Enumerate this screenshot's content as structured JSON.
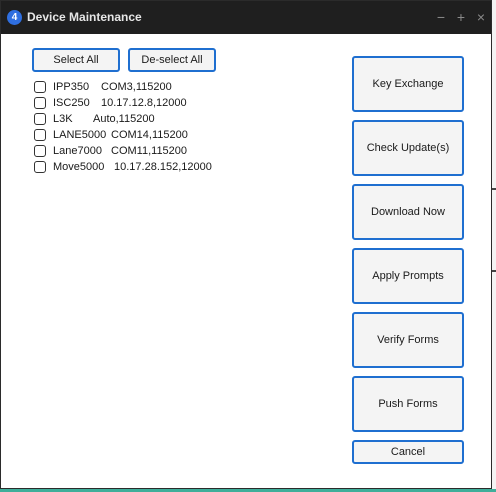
{
  "window": {
    "title": "Device Maintenance",
    "app_icon_label": "4",
    "controls": {
      "minimize": "−",
      "maximize": "+",
      "close": "×"
    }
  },
  "selection": {
    "select_all": "Select All",
    "deselect_all": "De-select All"
  },
  "devices": [
    {
      "name": "IPP350",
      "connection": "COM3,115200",
      "checked": false
    },
    {
      "name": "ISC250",
      "connection": "10.17.12.8,12000",
      "checked": false
    },
    {
      "name": "L3K",
      "connection": "Auto,115200",
      "checked": false
    },
    {
      "name": "LANE5000",
      "connection": "COM14,115200",
      "checked": false
    },
    {
      "name": "Lane7000",
      "connection": "COM11,115200",
      "checked": false
    },
    {
      "name": "Move5000",
      "connection": "10.17.28.152,12000",
      "checked": false
    }
  ],
  "actions": {
    "key_exchange": "Key Exchange",
    "check_updates": "Check Update(s)",
    "download_now": "Download Now",
    "apply_prompts": "Apply Prompts",
    "verify_forms": "Verify Forms",
    "push_forms": "Push Forms",
    "cancel": "Cancel"
  },
  "colors": {
    "titlebar": "#1f1f1f",
    "accent_border": "#1f6fd0",
    "app_icon": "#2f6fe0"
  }
}
